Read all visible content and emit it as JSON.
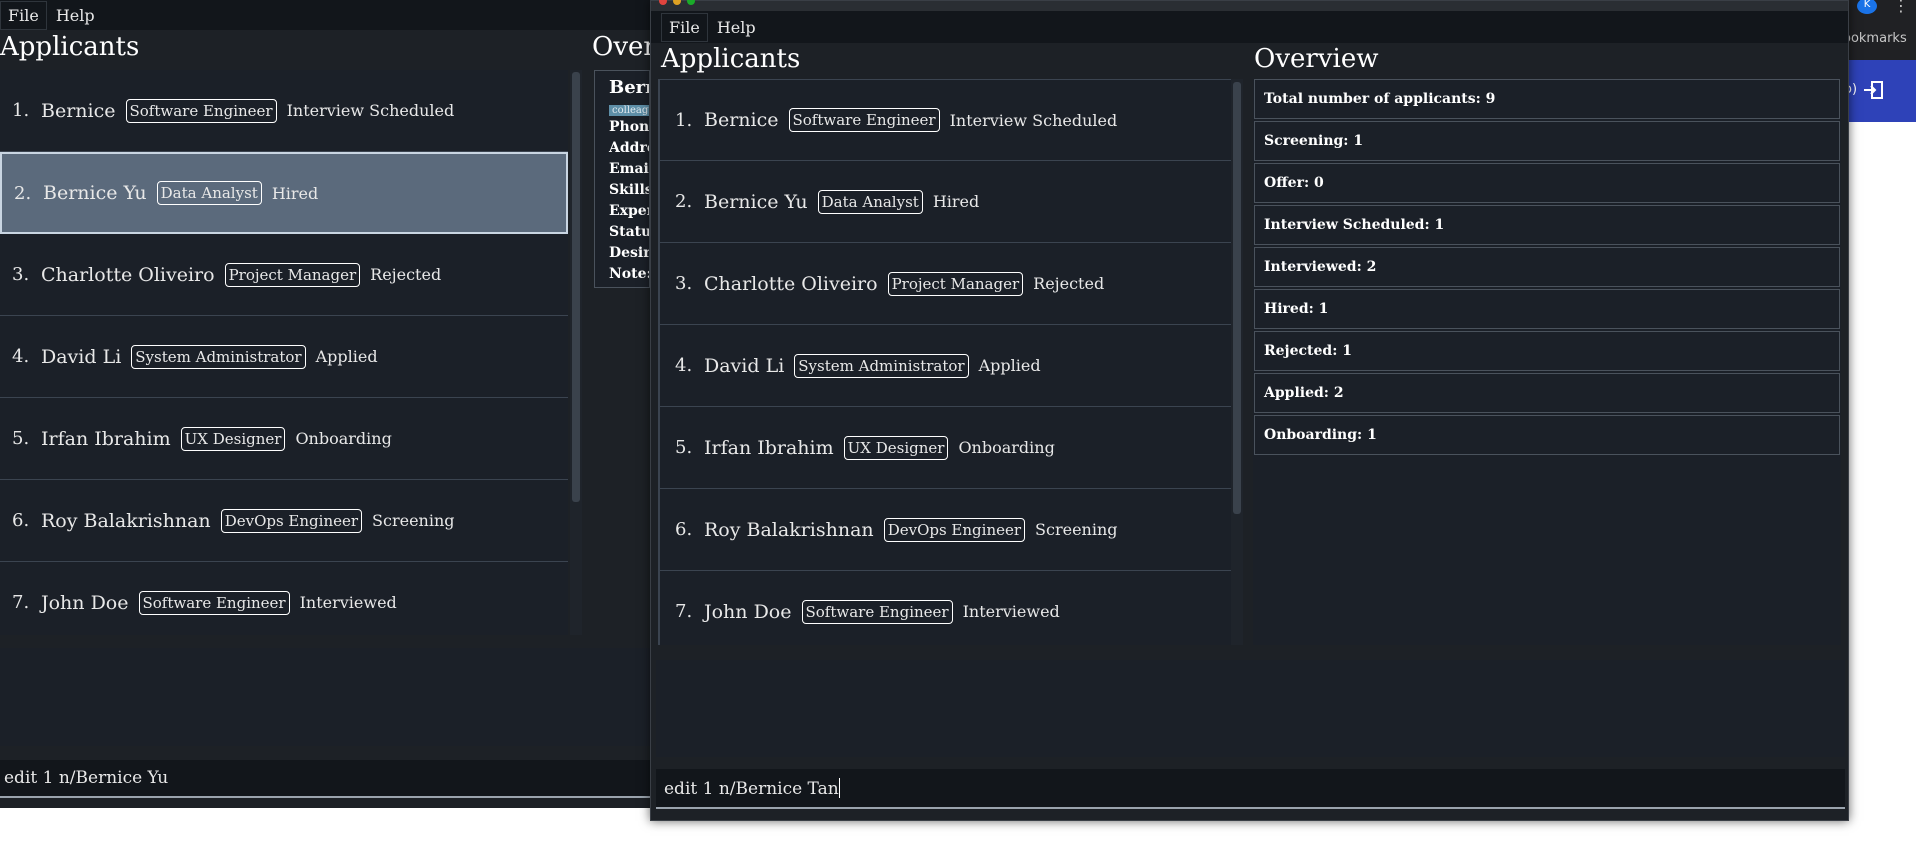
{
  "menu": {
    "file": "File",
    "help": "Help"
  },
  "bg_window": {
    "title": "Applicants",
    "overview_title": "Overview",
    "selected_index": 1,
    "applicants": [
      {
        "index": "1.",
        "name": "Bernice",
        "role": "Software Engineer",
        "status": "Interview Scheduled"
      },
      {
        "index": "2.",
        "name": "Bernice Yu",
        "role": "Data Analyst",
        "status": "Hired"
      },
      {
        "index": "3.",
        "name": "Charlotte Oliveiro",
        "role": "Project Manager",
        "status": "Rejected"
      },
      {
        "index": "4.",
        "name": "David Li",
        "role": "System Administrator",
        "status": "Applied"
      },
      {
        "index": "5.",
        "name": "Irfan Ibrahim",
        "role": "UX Designer",
        "status": "Onboarding"
      },
      {
        "index": "6.",
        "name": "Roy Balakrishnan",
        "role": "DevOps Engineer",
        "status": "Screening"
      },
      {
        "index": "7.",
        "name": "John Doe",
        "role": "Software Engineer",
        "status": "Interviewed"
      }
    ],
    "detail": {
      "name": "Bernice Yu",
      "tag": "colleagues",
      "fields": [
        "Phone:",
        "Address:",
        "Email:",
        "Skills:",
        "Experience:",
        "Status:",
        "Desired role:",
        "Note:"
      ]
    },
    "command": "edit 1 n/Bernice Yu"
  },
  "fg_window": {
    "title": "Applicants",
    "overview_title": "Overview",
    "applicants": [
      {
        "index": "1.",
        "name": "Bernice",
        "role": "Software Engineer",
        "status": "Interview Scheduled"
      },
      {
        "index": "2.",
        "name": "Bernice Yu",
        "role": "Data Analyst",
        "status": "Hired"
      },
      {
        "index": "3.",
        "name": "Charlotte Oliveiro",
        "role": "Project Manager",
        "status": "Rejected"
      },
      {
        "index": "4.",
        "name": "David Li",
        "role": "System Administrator",
        "status": "Applied"
      },
      {
        "index": "5.",
        "name": "Irfan Ibrahim",
        "role": "UX Designer",
        "status": "Onboarding"
      },
      {
        "index": "6.",
        "name": "Roy Balakrishnan",
        "role": "DevOps Engineer",
        "status": "Screening"
      },
      {
        "index": "7.",
        "name": "John Doe",
        "role": "Software Engineer",
        "status": "Interviewed"
      }
    ],
    "overview": [
      "Total number of applicants: 9",
      "Screening: 1",
      "Offer: 0",
      "Interview Scheduled: 1",
      "Interviewed: 2",
      "Hired: 1",
      "Rejected: 1",
      "Applied: 2",
      "Onboarding: 1"
    ],
    "command": "edit 1 n/Bernice Tan"
  },
  "browser": {
    "bookmarks_fragment": "ookmarks",
    "profile_initial": "K",
    "banner_fragment": "o)"
  },
  "colors": {
    "window_bg": "#1d2126",
    "panel_bg": "#1b2028",
    "selected_row": "#5b6a7c",
    "banner_blue": "#2e42b8"
  }
}
